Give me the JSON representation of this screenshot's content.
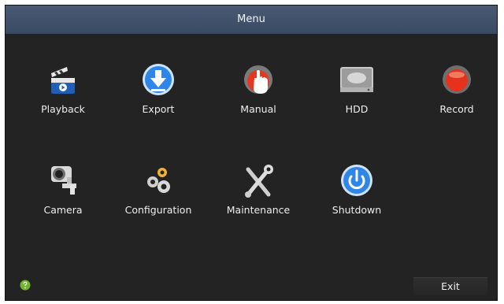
{
  "window": {
    "title": "Menu"
  },
  "menu": {
    "items": [
      {
        "label": "Playback",
        "icon": "playback-icon"
      },
      {
        "label": "Export",
        "icon": "export-icon"
      },
      {
        "label": "Manual",
        "icon": "manual-icon"
      },
      {
        "label": "HDD",
        "icon": "hdd-icon"
      },
      {
        "label": "Record",
        "icon": "record-icon"
      },
      {
        "label": "Camera",
        "icon": "camera-icon"
      },
      {
        "label": "Configuration",
        "icon": "configuration-icon"
      },
      {
        "label": "Maintenance",
        "icon": "maintenance-icon"
      },
      {
        "label": "Shutdown",
        "icon": "shutdown-icon"
      }
    ]
  },
  "footer": {
    "help_icon": "help-icon",
    "exit_label": "Exit"
  },
  "colors": {
    "title_bar": "#3f4f68",
    "background": "#232323",
    "accent_blue": "#2f86e6",
    "record_red": "#e5321d"
  }
}
